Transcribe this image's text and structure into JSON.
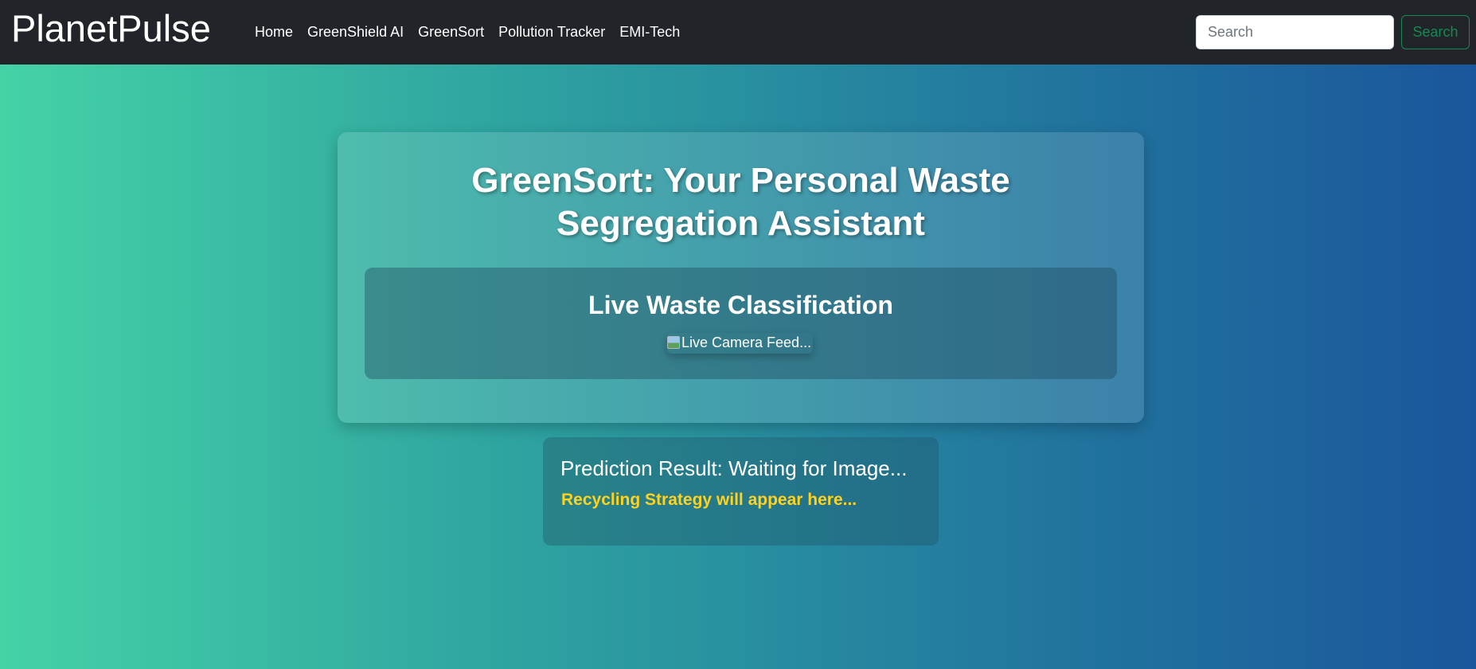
{
  "navbar": {
    "brand": "PlanetPulse",
    "links": [
      "Home",
      "GreenShield AI",
      "GreenSort",
      "Pollution Tracker",
      "EMI-Tech"
    ],
    "search_placeholder": "Search",
    "search_button": "Search"
  },
  "main": {
    "title": "GreenSort: Your Personal Waste Segregation Assistant",
    "live_section": {
      "title": "Live Waste Classification",
      "camera_alt": "Live Camera Feed..."
    }
  },
  "result": {
    "prediction": "Prediction Result: Waiting for Image...",
    "strategy": "Recycling Strategy will appear here..."
  },
  "colors": {
    "navbar_bg": "#212529",
    "gradient_start": "#45d2a6",
    "gradient_end": "#1a569b",
    "search_button": "#198754",
    "strategy_text": "#ffd21f"
  }
}
